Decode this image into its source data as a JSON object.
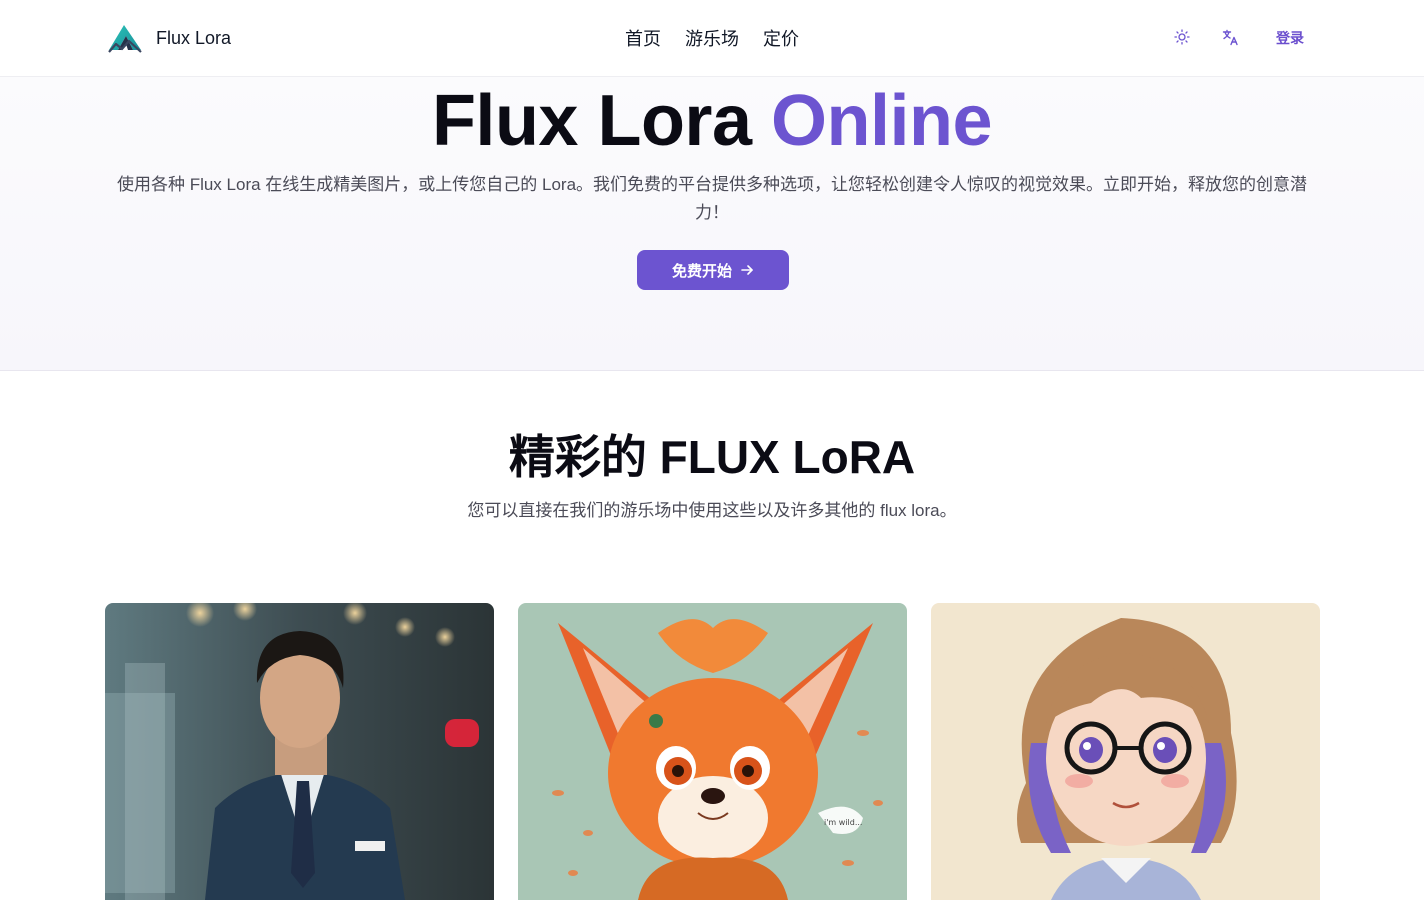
{
  "header": {
    "brand_name": "Flux Lora",
    "nav": [
      "首页",
      "游乐场",
      "定价"
    ],
    "theme_icon": "sun-icon",
    "language_icon": "translate-icon",
    "login_label": "登录"
  },
  "hero": {
    "title_main": "Flux Lora",
    "title_accent": "Online",
    "description": "使用各种 Flux Lora 在线生成精美图片，或上传您自己的 Lora。我们免费的平台提供多种选项，让您轻松创建令人惊叹的视觉效果。立即开始，释放您的创意潜力！",
    "cta_label": "免费开始"
  },
  "section": {
    "title": "精彩的 FLUX LoRA",
    "subtitle": "您可以直接在我们的游乐场中使用这些以及许多其他的 flux lora。"
  },
  "gallery": {
    "card3_speech": "i'm wild..."
  },
  "colors": {
    "accent": "#6c54d0",
    "text_dark": "#0b0b14",
    "text_muted": "#4b4b57"
  }
}
